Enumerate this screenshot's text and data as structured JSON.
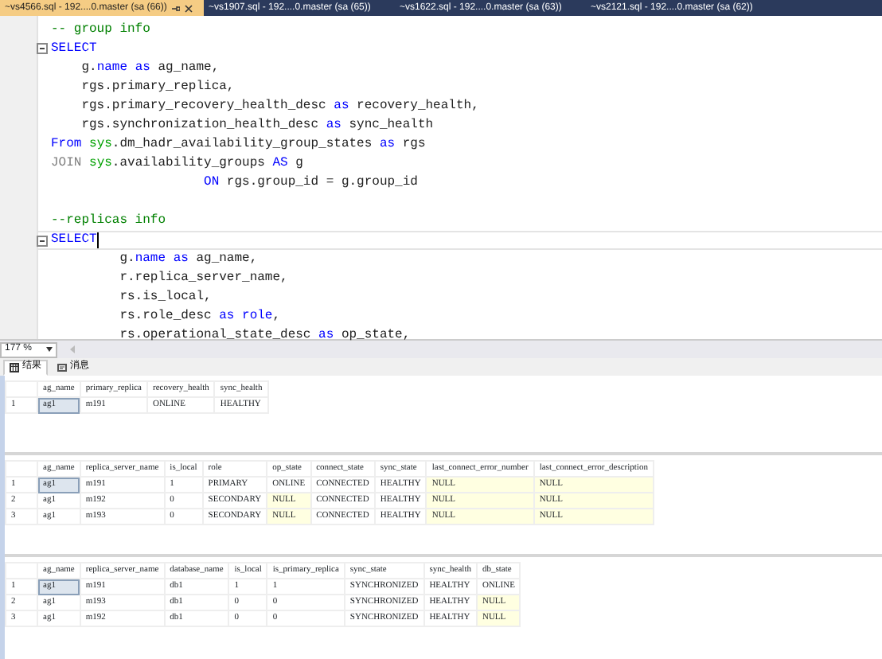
{
  "tabs": [
    {
      "title": "~vs4566.sql - 192....0.master (sa (66))",
      "selected": true
    },
    {
      "title": "~vs1907.sql - 192....0.master (sa (65))",
      "selected": false
    },
    {
      "title": "~vs1622.sql - 192....0.master (sa (63))",
      "selected": false
    },
    {
      "title": "~vs2121.sql - 192....0.master (sa (62))",
      "selected": false
    }
  ],
  "editor": {
    "lines": [
      {
        "fold": false,
        "current": false,
        "tokens": [
          {
            "kind": "comment",
            "text": "-- group info"
          }
        ]
      },
      {
        "fold": true,
        "current": false,
        "tokens": [
          {
            "kind": "keyword",
            "text": "SELECT"
          }
        ]
      },
      {
        "fold": false,
        "current": false,
        "tokens": [
          {
            "kind": "plain",
            "text": "    g."
          },
          {
            "kind": "keyword",
            "text": "name as"
          },
          {
            "kind": "plain",
            "text": " ag_name,"
          }
        ]
      },
      {
        "fold": false,
        "current": false,
        "tokens": [
          {
            "kind": "plain",
            "text": "    rgs.primary_replica,"
          }
        ]
      },
      {
        "fold": false,
        "current": false,
        "tokens": [
          {
            "kind": "plain",
            "text": "    rgs.primary_recovery_health_desc "
          },
          {
            "kind": "keyword",
            "text": "as"
          },
          {
            "kind": "plain",
            "text": " recovery_health,"
          }
        ]
      },
      {
        "fold": false,
        "current": false,
        "tokens": [
          {
            "kind": "plain",
            "text": "    rgs.synchronization_health_desc "
          },
          {
            "kind": "keyword",
            "text": "as"
          },
          {
            "kind": "plain",
            "text": " sync_health"
          }
        ]
      },
      {
        "fold": false,
        "current": false,
        "tokens": [
          {
            "kind": "keyword",
            "text": "From "
          },
          {
            "kind": "system",
            "text": "sys"
          },
          {
            "kind": "plain",
            "text": ".dm_hadr_availability_group_states "
          },
          {
            "kind": "keyword",
            "text": "as"
          },
          {
            "kind": "plain",
            "text": " rgs"
          }
        ]
      },
      {
        "fold": false,
        "current": false,
        "tokens": [
          {
            "kind": "operator",
            "text": "JOIN "
          },
          {
            "kind": "system",
            "text": "sys"
          },
          {
            "kind": "plain",
            "text": ".availability_groups "
          },
          {
            "kind": "keyword",
            "text": "AS"
          },
          {
            "kind": "plain",
            "text": " g"
          }
        ]
      },
      {
        "fold": false,
        "current": false,
        "tokens": [
          {
            "kind": "keyword",
            "text": "                    ON"
          },
          {
            "kind": "plain",
            "text": " rgs.group_id = g.group_id"
          }
        ]
      },
      {
        "fold": false,
        "current": false
      },
      {
        "fold": false,
        "current": false,
        "tokens": [
          {
            "kind": "comment",
            "text": "--replicas info"
          }
        ]
      },
      {
        "fold": true,
        "current": true,
        "tokens": [
          {
            "kind": "keyword",
            "text": "SELECT"
          }
        ]
      },
      {
        "fold": false,
        "current": false,
        "tokens": [
          {
            "kind": "plain",
            "text": "         g."
          },
          {
            "kind": "keyword",
            "text": "name as"
          },
          {
            "kind": "plain",
            "text": " ag_name,"
          }
        ]
      },
      {
        "fold": false,
        "current": false,
        "tokens": [
          {
            "kind": "plain",
            "text": "         r.replica_server_name,"
          }
        ]
      },
      {
        "fold": false,
        "current": false,
        "tokens": [
          {
            "kind": "plain",
            "text": "         rs.is_local,"
          }
        ]
      },
      {
        "fold": false,
        "current": false,
        "tokens": [
          {
            "kind": "plain",
            "text": "         rs.role_desc "
          },
          {
            "kind": "keyword",
            "text": "as role"
          },
          {
            "kind": "plain",
            "text": ","
          }
        ]
      },
      {
        "fold": false,
        "current": false,
        "tokens": [
          {
            "kind": "plain",
            "text": "         rs.operational_state_desc "
          },
          {
            "kind": "keyword",
            "text": "as"
          },
          {
            "kind": "plain",
            "text": " op_state,"
          }
        ]
      }
    ]
  },
  "zoom": "177 %",
  "result_tabs": [
    {
      "label": "结果",
      "selected": true
    },
    {
      "label": "消息",
      "selected": false
    }
  ],
  "grids": [
    {
      "columns": [
        "ag_name",
        "primary_replica",
        "recovery_health",
        "sync_health"
      ],
      "rows": [
        {
          "number": "1",
          "cells": [
            {
              "text": "ag1",
              "null": false,
              "selected": true
            },
            {
              "text": "m191",
              "null": false,
              "selected": false
            },
            {
              "text": "ONLINE",
              "null": false,
              "selected": false
            },
            {
              "text": "HEALTHY",
              "null": false,
              "selected": false
            }
          ]
        }
      ]
    },
    {
      "columns": [
        "ag_name",
        "replica_server_name",
        "is_local",
        "role",
        "op_state",
        "connect_state",
        "sync_state",
        "last_connect_error_number",
        "last_connect_error_description"
      ],
      "rows": [
        {
          "number": "1",
          "cells": [
            {
              "text": "ag1",
              "null": false,
              "selected": true
            },
            {
              "text": "m191",
              "null": false,
              "selected": false
            },
            {
              "text": "1",
              "null": false,
              "selected": false
            },
            {
              "text": "PRIMARY",
              "null": false,
              "selected": false
            },
            {
              "text": "ONLINE",
              "null": false,
              "selected": false
            },
            {
              "text": "CONNECTED",
              "null": false,
              "selected": false
            },
            {
              "text": "HEALTHY",
              "null": false,
              "selected": false
            },
            {
              "text": "NULL",
              "null": true,
              "selected": false
            },
            {
              "text": "NULL",
              "null": true,
              "selected": false
            }
          ]
        },
        {
          "number": "2",
          "cells": [
            {
              "text": "ag1",
              "null": false,
              "selected": false
            },
            {
              "text": "m192",
              "null": false,
              "selected": false
            },
            {
              "text": "0",
              "null": false,
              "selected": false
            },
            {
              "text": "SECONDARY",
              "null": false,
              "selected": false
            },
            {
              "text": "NULL",
              "null": true,
              "selected": false
            },
            {
              "text": "CONNECTED",
              "null": false,
              "selected": false
            },
            {
              "text": "HEALTHY",
              "null": false,
              "selected": false
            },
            {
              "text": "NULL",
              "null": true,
              "selected": false
            },
            {
              "text": "NULL",
              "null": true,
              "selected": false
            }
          ]
        },
        {
          "number": "3",
          "cells": [
            {
              "text": "ag1",
              "null": false,
              "selected": false
            },
            {
              "text": "m193",
              "null": false,
              "selected": false
            },
            {
              "text": "0",
              "null": false,
              "selected": false
            },
            {
              "text": "SECONDARY",
              "null": false,
              "selected": false
            },
            {
              "text": "NULL",
              "null": true,
              "selected": false
            },
            {
              "text": "CONNECTED",
              "null": false,
              "selected": false
            },
            {
              "text": "HEALTHY",
              "null": false,
              "selected": false
            },
            {
              "text": "NULL",
              "null": true,
              "selected": false
            },
            {
              "text": "NULL",
              "null": true,
              "selected": false
            }
          ]
        }
      ]
    },
    {
      "columns": [
        "ag_name",
        "replica_server_name",
        "database_name",
        "is_local",
        "is_primary_replica",
        "sync_state",
        "sync_health",
        "db_state"
      ],
      "rows": [
        {
          "number": "1",
          "cells": [
            {
              "text": "ag1",
              "null": false,
              "selected": true
            },
            {
              "text": "m191",
              "null": false,
              "selected": false
            },
            {
              "text": "db1",
              "null": false,
              "selected": false
            },
            {
              "text": "1",
              "null": false,
              "selected": false
            },
            {
              "text": "1",
              "null": false,
              "selected": false
            },
            {
              "text": "SYNCHRONIZED",
              "null": false,
              "selected": false
            },
            {
              "text": "HEALTHY",
              "null": false,
              "selected": false
            },
            {
              "text": "ONLINE",
              "null": false,
              "selected": false
            }
          ]
        },
        {
          "number": "2",
          "cells": [
            {
              "text": "ag1",
              "null": false,
              "selected": false
            },
            {
              "text": "m193",
              "null": false,
              "selected": false
            },
            {
              "text": "db1",
              "null": false,
              "selected": false
            },
            {
              "text": "0",
              "null": false,
              "selected": false
            },
            {
              "text": "0",
              "null": false,
              "selected": false
            },
            {
              "text": "SYNCHRONIZED",
              "null": false,
              "selected": false
            },
            {
              "text": "HEALTHY",
              "null": false,
              "selected": false
            },
            {
              "text": "NULL",
              "null": true,
              "selected": false
            }
          ]
        },
        {
          "number": "3",
          "cells": [
            {
              "text": "ag1",
              "null": false,
              "selected": false
            },
            {
              "text": "m192",
              "null": false,
              "selected": false
            },
            {
              "text": "db1",
              "null": false,
              "selected": false
            },
            {
              "text": "0",
              "null": false,
              "selected": false
            },
            {
              "text": "0",
              "null": false,
              "selected": false
            },
            {
              "text": "SYNCHRONIZED",
              "null": false,
              "selected": false
            },
            {
              "text": "HEALTHY",
              "null": false,
              "selected": false
            },
            {
              "text": "NULL",
              "null": true,
              "selected": false
            }
          ]
        }
      ]
    }
  ]
}
